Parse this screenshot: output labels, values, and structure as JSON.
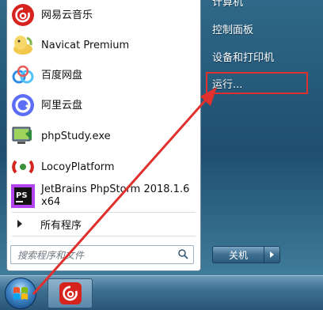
{
  "programs": [
    {
      "label": "网易云音乐",
      "icon": "netease-music-icon"
    },
    {
      "label": "Navicat Premium",
      "icon": "navicat-icon"
    },
    {
      "label": "百度网盘",
      "icon": "baidu-netdisk-icon"
    },
    {
      "label": "阿里云盘",
      "icon": "aliyun-drive-icon"
    },
    {
      "label": "phpStudy.exe",
      "icon": "phpstudy-icon"
    },
    {
      "label": "LocoyPlatform",
      "icon": "locoy-icon"
    },
    {
      "label_line1": "JetBrains PhpStorm 2018.1.6",
      "label_line2": "x64",
      "icon": "phpstorm-icon"
    }
  ],
  "all_programs_label": "所有程序",
  "search": {
    "placeholder": "搜索程序和文件"
  },
  "right_pane": {
    "top_item": "计算机",
    "control_panel": "控制面板",
    "devices_printers": "设备和打印机",
    "run": "运行..."
  },
  "shutdown_label": "关机",
  "colors": {
    "highlight": "#e0302e",
    "arrow": "#e0302e"
  }
}
